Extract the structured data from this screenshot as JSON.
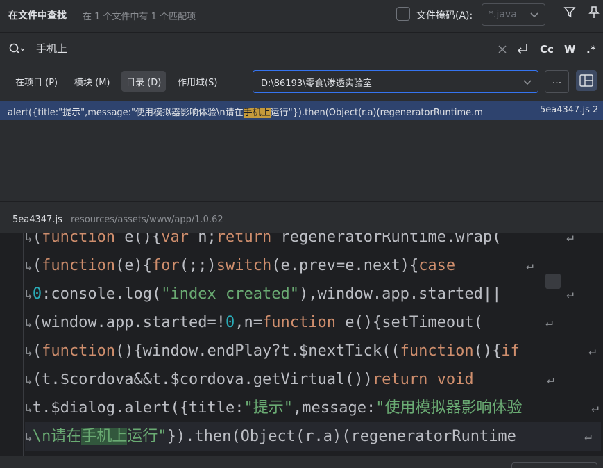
{
  "header": {
    "title": "在文件中查找",
    "subtitle": "在 1 个文件中有 1 个匹配项",
    "file_mask_label": "文件掩码(A):",
    "file_mask_value": "*.java"
  },
  "search": {
    "query": "手机上",
    "option_case": "Cc",
    "option_words": "W",
    "option_regex": ".*"
  },
  "scope": {
    "tabs": [
      "在项目 (P)",
      "模块 (M)",
      "目录 (D)",
      "作用域(S)"
    ],
    "active_tab": "目录 (D)",
    "directory": "D:\\86193\\零食\\渗透实验室",
    "browse_label": "..."
  },
  "results": [
    {
      "before": "alert({title:\"提示\",message:\"使用模拟器影响体验\\n请在",
      "match": "手机上",
      "after": "运行\"}).then(Object(r.a)(regeneratorRuntime.m",
      "location": "5ea4347.js 2"
    }
  ],
  "file": {
    "name": "5ea4347.js",
    "path": "resources/assets/www/app/1.0.62"
  },
  "code_lines": [
    {
      "segments": [
        {
          "t": "(",
          "c": ""
        },
        {
          "t": "function",
          "c": "kw"
        },
        {
          "t": " e(){",
          "c": ""
        },
        {
          "t": "var",
          "c": "kw"
        },
        {
          "t": " n;",
          "c": ""
        },
        {
          "t": "return",
          "c": "kw"
        },
        {
          "t": " regeneratorRuntime.wrap(",
          "c": ""
        }
      ]
    },
    {
      "segments": [
        {
          "t": "(",
          "c": ""
        },
        {
          "t": "function",
          "c": "kw"
        },
        {
          "t": "(e){",
          "c": ""
        },
        {
          "t": "for",
          "c": "kw"
        },
        {
          "t": "(;;)",
          "c": ""
        },
        {
          "t": "switch",
          "c": "kw"
        },
        {
          "t": "(e.prev=e.next){",
          "c": ""
        },
        {
          "t": "case",
          "c": "kw"
        }
      ]
    },
    {
      "segments": [
        {
          "t": "0",
          "c": "num"
        },
        {
          "t": ":console.log(",
          "c": ""
        },
        {
          "t": "\"index created\"",
          "c": "str"
        },
        {
          "t": "),window.app.started||",
          "c": ""
        }
      ]
    },
    {
      "segments": [
        {
          "t": "(window.app.started=!",
          "c": ""
        },
        {
          "t": "0",
          "c": "num"
        },
        {
          "t": ",n=",
          "c": ""
        },
        {
          "t": "function",
          "c": "kw"
        },
        {
          "t": " e(){setTimeout(",
          "c": ""
        }
      ]
    },
    {
      "segments": [
        {
          "t": "(",
          "c": ""
        },
        {
          "t": "function",
          "c": "kw"
        },
        {
          "t": "(){window.endPlay?t.$nextTick((",
          "c": ""
        },
        {
          "t": "function",
          "c": "kw"
        },
        {
          "t": "(){",
          "c": ""
        },
        {
          "t": "if",
          "c": "kw"
        }
      ]
    },
    {
      "segments": [
        {
          "t": "(t.$cordova&&t.$cordova.getVirtual())",
          "c": ""
        },
        {
          "t": "return",
          "c": "kw"
        },
        {
          "t": " ",
          "c": ""
        },
        {
          "t": "void",
          "c": "kw"
        }
      ]
    },
    {
      "segments": [
        {
          "t": "t.$dialog.alert({title:",
          "c": ""
        },
        {
          "t": "\"提示\"",
          "c": "str"
        },
        {
          "t": ",message:",
          "c": ""
        },
        {
          "t": "\"使用模拟器影响体验",
          "c": "str"
        }
      ]
    },
    {
      "segments": [
        {
          "t": "\\n请在",
          "c": "str"
        },
        {
          "t": "手机上",
          "c": "str match"
        },
        {
          "t": "运行\"",
          "c": "str"
        },
        {
          "t": "}).then(Object(r.a)(regeneratorRuntime",
          "c": ""
        }
      ]
    }
  ]
}
